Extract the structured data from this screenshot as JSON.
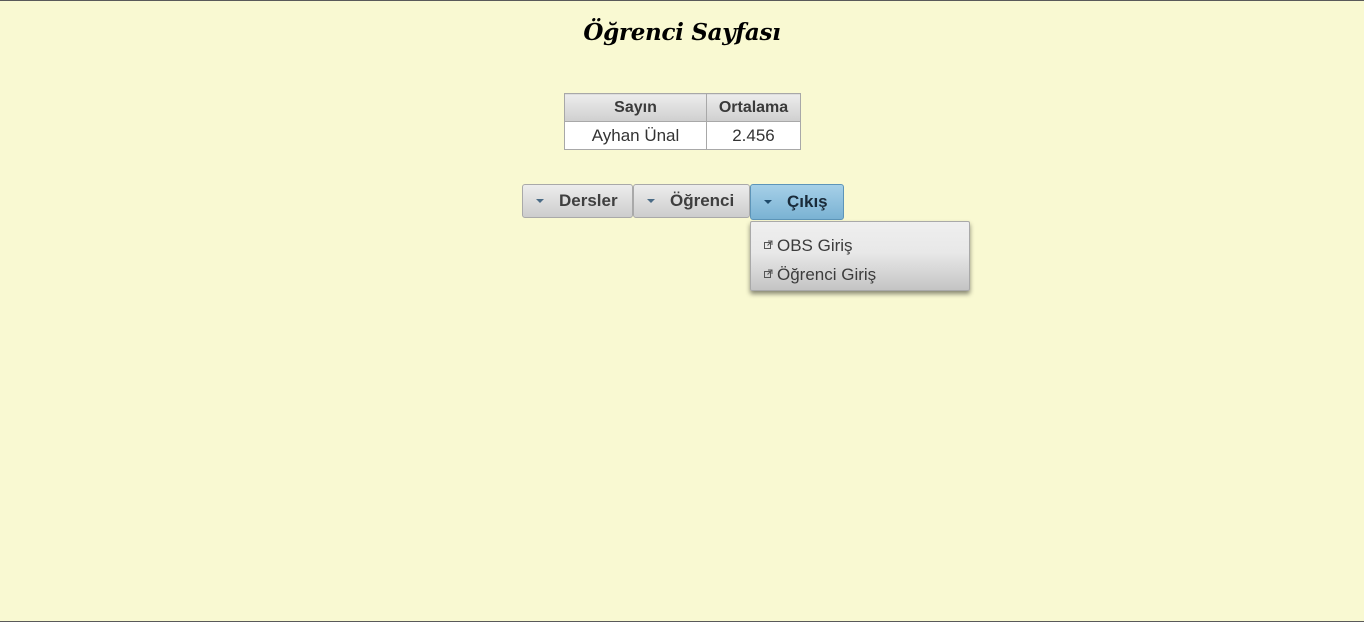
{
  "page": {
    "title": "Öğrenci Sayfası"
  },
  "table": {
    "headers": [
      "Sayın",
      "Ortalama"
    ],
    "rows": [
      [
        "Ayhan Ünal",
        "2.456"
      ]
    ]
  },
  "menu": {
    "items": [
      {
        "label": "Dersler",
        "icon": "triangle-down-icon"
      },
      {
        "label": "Öğrenci",
        "icon": "triangle-down-icon"
      },
      {
        "label": "Çıkış",
        "icon": "triangle-down-icon",
        "active": true
      }
    ],
    "dropdown": [
      {
        "label": "OBS Giriş",
        "icon": "external-link-icon"
      },
      {
        "label": "Öğrenci Giriş",
        "icon": "external-link-icon"
      }
    ]
  },
  "colors": {
    "background": "#f9f9d2",
    "active_menu": "#7ab2d3"
  }
}
